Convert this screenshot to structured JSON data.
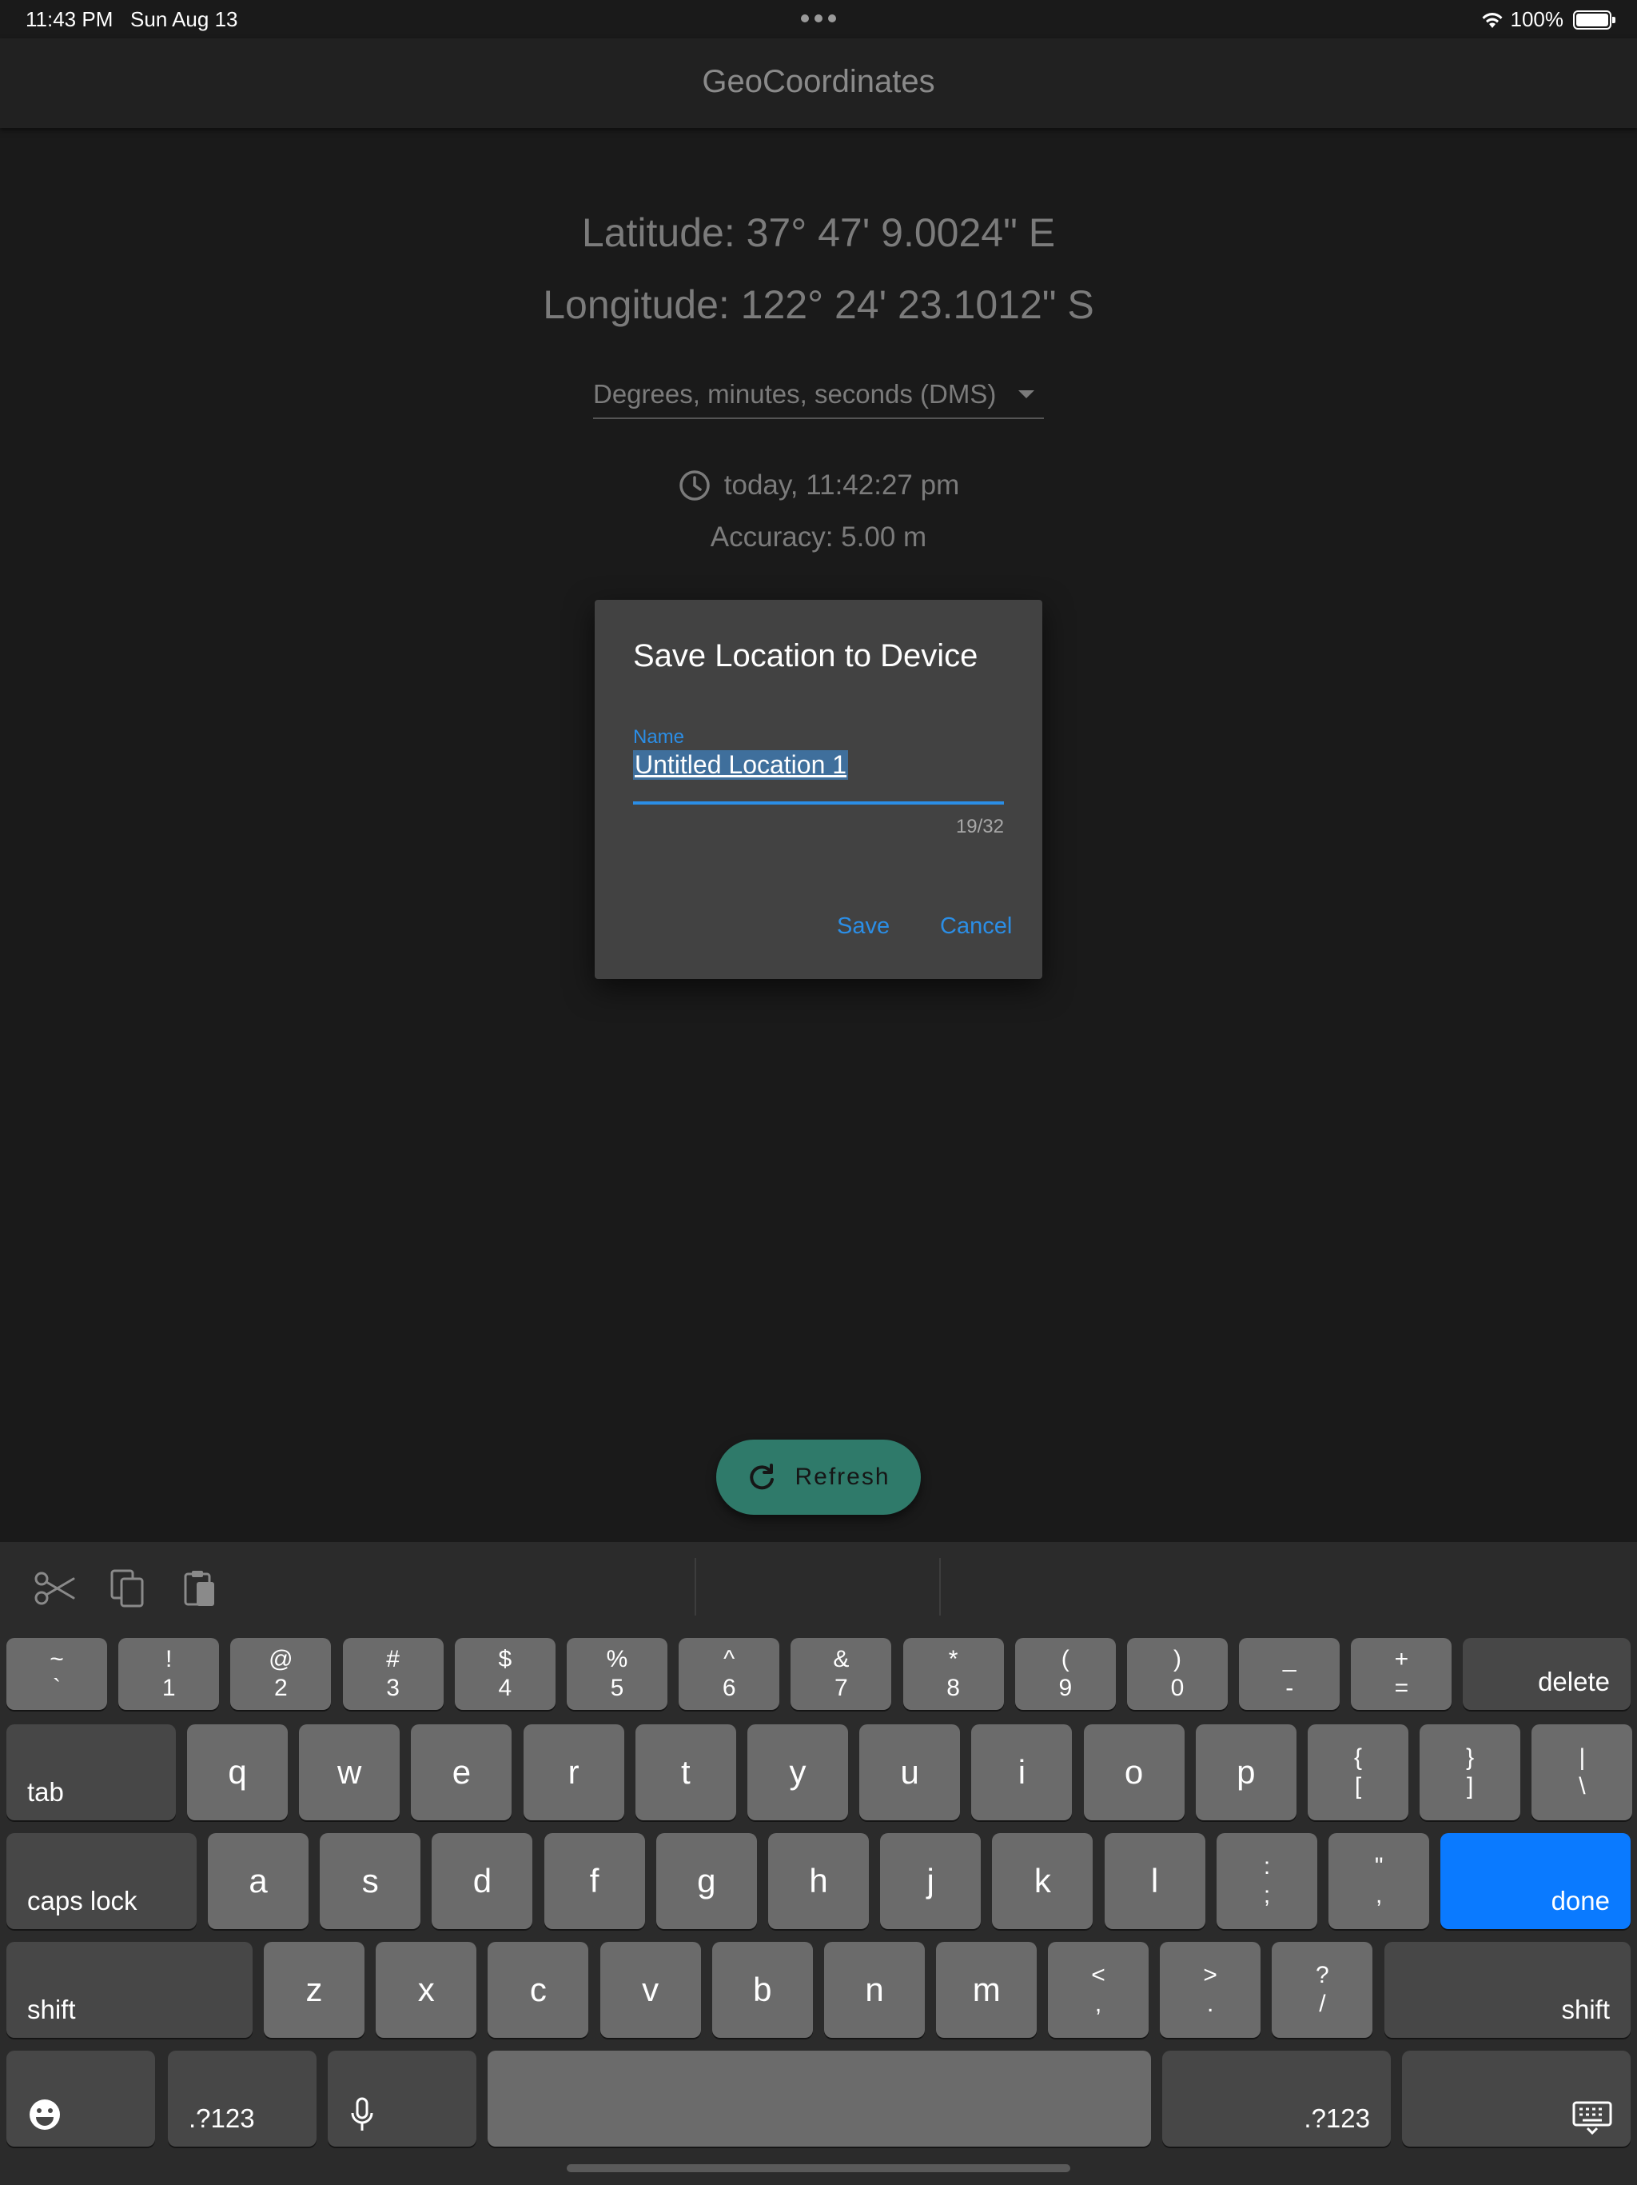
{
  "status_bar": {
    "time": "11:43 PM",
    "date": "Sun Aug 13",
    "battery": "100%"
  },
  "app_bar": {
    "title": "GeoCoordinates"
  },
  "coordinates": {
    "latitude": "Latitude: 37° 47' 9.0024\" E",
    "longitude": "Longitude: 122° 24' 23.1012\" S"
  },
  "format_select": {
    "selected": "Degrees, minutes, seconds (DMS)"
  },
  "timestamp": "today, 11:42:27 pm",
  "accuracy": "Accuracy: 5.00 m",
  "dialog": {
    "title": "Save Location to Device",
    "field_label": "Name",
    "field_value": "Untitled Location 1",
    "counter": "19/32",
    "save_label": "Save",
    "cancel_label": "Cancel"
  },
  "refresh_label": "Refresh",
  "keyboard": {
    "row1": [
      {
        "t": "~",
        "b": "`"
      },
      {
        "t": "!",
        "b": "1"
      },
      {
        "t": "@",
        "b": "2"
      },
      {
        "t": "#",
        "b": "3"
      },
      {
        "t": "$",
        "b": "4"
      },
      {
        "t": "%",
        "b": "5"
      },
      {
        "t": "^",
        "b": "6"
      },
      {
        "t": "&",
        "b": "7"
      },
      {
        "t": "*",
        "b": "8"
      },
      {
        "t": "(",
        "b": "9"
      },
      {
        "t": ")",
        "b": "0"
      },
      {
        "t": "_",
        "b": "-"
      },
      {
        "t": "+",
        "b": "="
      }
    ],
    "delete": "delete",
    "tab": "tab",
    "row2": [
      "q",
      "w",
      "e",
      "r",
      "t",
      "y",
      "u",
      "i",
      "o",
      "p"
    ],
    "row2_sym": [
      {
        "t": "{",
        "b": "["
      },
      {
        "t": "}",
        "b": "]"
      },
      {
        "t": "|",
        "b": "\\"
      }
    ],
    "caps_lock": "caps lock",
    "row3": [
      "a",
      "s",
      "d",
      "f",
      "g",
      "h",
      "j",
      "k",
      "l"
    ],
    "row3_sym": [
      {
        "t": ":",
        "b": ";"
      },
      {
        "t": "\"",
        "b": ","
      }
    ],
    "done": "done",
    "shift": "shift",
    "row4": [
      "z",
      "x",
      "c",
      "v",
      "b",
      "n",
      "m"
    ],
    "row4_sym": [
      {
        "t": "<",
        "b": ","
      },
      {
        "t": ">",
        "b": "."
      },
      {
        "t": "?",
        "b": "/"
      }
    ],
    "numbers": ".?123"
  },
  "colors": {
    "accent": "#2b8ee6",
    "fab": "#2f7a6a",
    "done_key": "#0a7aff"
  }
}
